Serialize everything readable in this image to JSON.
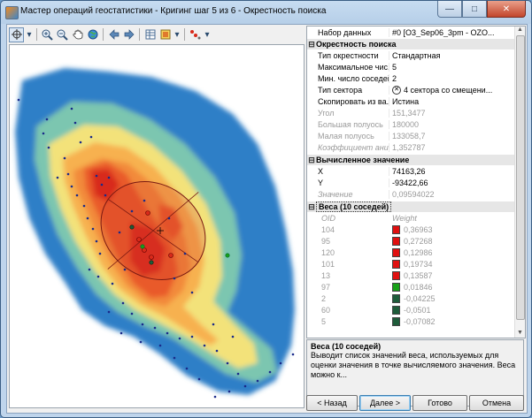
{
  "window": {
    "title": "Мастер операций геостатистики - Кригинг шаг 5 из 6 - Окрестность поиска",
    "minimize_glyph": "—",
    "maximize_glyph": "□",
    "close_glyph": "✕"
  },
  "toolbar": {
    "icons": [
      "select-pointer-icon",
      "zoom-in-icon",
      "zoom-out-icon",
      "pan-hand-icon",
      "full-extent-icon",
      "back-arrow-icon",
      "forward-arrow-icon",
      "table-icon",
      "layer-icon",
      "weights-icon"
    ]
  },
  "properties": {
    "top_row": {
      "label": "Набор данных",
      "value": "#0 [O3_Sep06_3pm - OZO..."
    },
    "sections": {
      "search": {
        "toggle": "⊟",
        "title": "Окрестность поиска",
        "rows": [
          {
            "label": "Тип окрестности",
            "value": "Стандартная"
          },
          {
            "label": "Максимальное чис...",
            "value": "5"
          },
          {
            "label": "Мин. число соседей",
            "value": "2"
          },
          {
            "label": "Тип сектора",
            "value": "4 сектора со смещени..."
          },
          {
            "label": "Скопировать из ва...",
            "value": "Истина"
          },
          {
            "label": "Угол",
            "value": "151,3477"
          },
          {
            "label": "Большая полуось",
            "value": "180000"
          },
          {
            "label": "Малая полуось",
            "value": "133058,7"
          },
          {
            "label": "Коэффициент ани...",
            "value": "1,352787"
          }
        ]
      },
      "computed": {
        "toggle": "⊟",
        "title": "Вычисленное значение",
        "rows": [
          {
            "label": "X",
            "value": "74163,26"
          },
          {
            "label": "Y",
            "value": "-93422,66"
          },
          {
            "label": "Значение",
            "value": "0,09594022"
          }
        ]
      },
      "weights": {
        "toggle": "⊟",
        "title": "Веса (10 соседей)",
        "col_oid": "OID",
        "col_weight": "Weight",
        "rows": [
          {
            "oid": "104",
            "weight": "0,36963",
            "color": "#e01010"
          },
          {
            "oid": "95",
            "weight": "0,27268",
            "color": "#e01010"
          },
          {
            "oid": "120",
            "weight": "0,12986",
            "color": "#e01010"
          },
          {
            "oid": "101",
            "weight": "0,19734",
            "color": "#e01010"
          },
          {
            "oid": "13",
            "weight": "0,13587",
            "color": "#e01010"
          },
          {
            "oid": "97",
            "weight": "0,01846",
            "color": "#18a018"
          },
          {
            "oid": "2",
            "weight": "-0,04225",
            "color": "#1e5c3a"
          },
          {
            "oid": "60",
            "weight": "-0,0501",
            "color": "#1e5c3a"
          },
          {
            "oid": "5",
            "weight": "-0,07082",
            "color": "#1e5c3a"
          }
        ]
      }
    }
  },
  "description": {
    "title": "Веса (10 соседей)",
    "body": "Выводит список значений веса, используемых для оценки значения в точке вычисляемого значения. Веса можно к..."
  },
  "buttons": {
    "back": "< Назад",
    "next": "Далее >",
    "finish": "Готово",
    "cancel": "Отмена"
  },
  "colors": {
    "low": "#2d7fc7",
    "mid_low": "#7cc6b0",
    "mid": "#f3e27a",
    "high": "#f28a3b",
    "peak": "#d82a1a",
    "point": "#1a2a8a"
  }
}
